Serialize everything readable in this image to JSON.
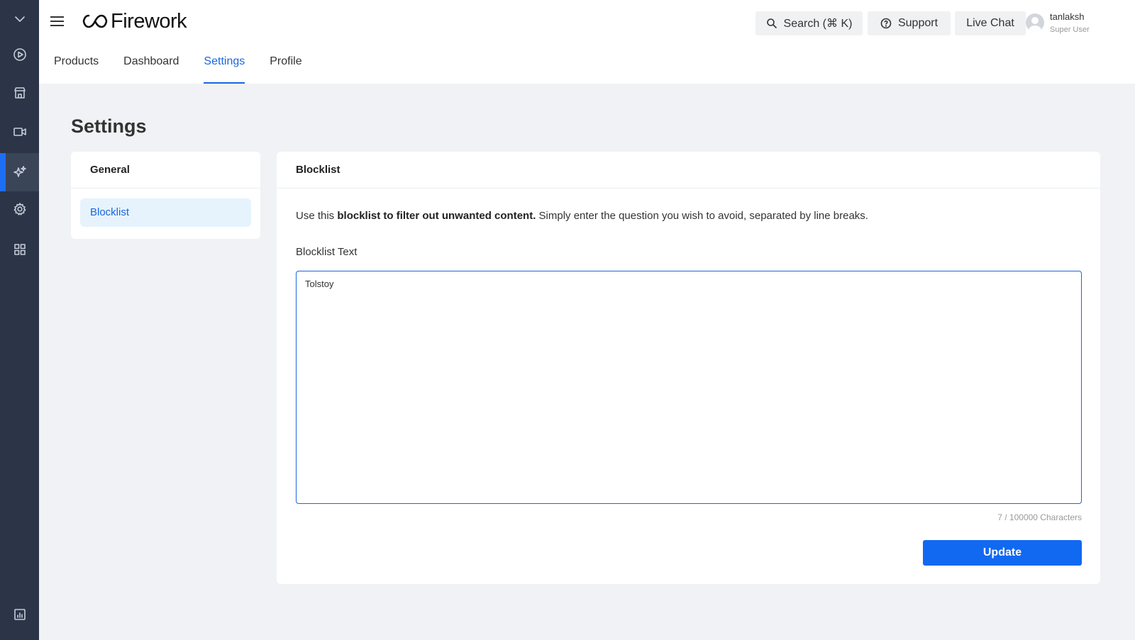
{
  "app": {
    "logo_text": "Firework"
  },
  "rail": {
    "items": [
      {
        "icon": "chevron-down-icon"
      },
      {
        "icon": "play-circle-icon"
      },
      {
        "icon": "store-icon"
      },
      {
        "icon": "video-camera-icon"
      },
      {
        "icon": "sparkles-icon",
        "active": true
      },
      {
        "icon": "gear-icon"
      },
      {
        "icon": "grid-icon"
      },
      {
        "icon": "analytics-icon"
      }
    ]
  },
  "header": {
    "search_label": "Search (⌘ K)",
    "support_label": "Support",
    "live_chat_label": "Live Chat",
    "user_name": "tanlaksh",
    "user_role": "Super User"
  },
  "tabs": [
    {
      "label": "Products",
      "active": false
    },
    {
      "label": "Dashboard",
      "active": false
    },
    {
      "label": "Settings",
      "active": true
    },
    {
      "label": "Profile",
      "active": false
    }
  ],
  "page": {
    "title": "Settings"
  },
  "side_nav": {
    "header": "General",
    "items": [
      {
        "label": "Blocklist",
        "selected": true
      }
    ]
  },
  "blocklist": {
    "title": "Blocklist",
    "description_prefix": "Use this ",
    "description_bold": "blocklist to filter out unwanted content.",
    "description_suffix": " Simply enter the question you wish to avoid, separated by line breaks.",
    "field_label": "Blocklist Text",
    "field_value": "Tolstoy",
    "char_count": "7 / 100000 Characters",
    "update_label": "Update"
  },
  "colors": {
    "accent": "#1a66e0",
    "button": "#1169f2",
    "rail": "#2c3547",
    "background": "#f0f2f5"
  }
}
